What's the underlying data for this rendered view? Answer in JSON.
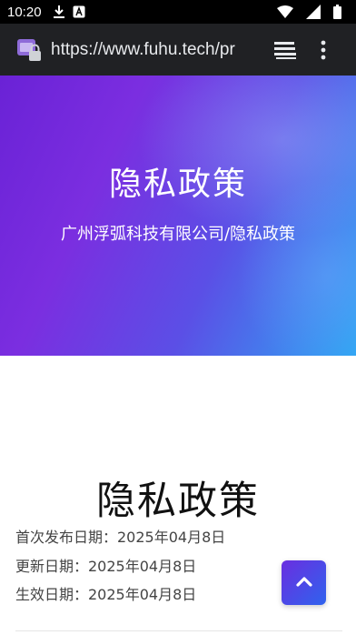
{
  "status_bar": {
    "time": "10:20",
    "icons_left": [
      "download-icon",
      "translate-icon"
    ],
    "icons_right": [
      "wifi-icon",
      "signal-icon",
      "battery-icon"
    ]
  },
  "browser": {
    "url": "https://www.fuhu.tech/pr",
    "icons": [
      "site-lock-icon",
      "tabs-icon",
      "overflow-menu-icon"
    ]
  },
  "hero": {
    "title": "隐私政策",
    "breadcrumb": "广州浮弧科技有限公司/隐私政策",
    "gradient_colors": [
      "#6a22d6",
      "#5b4fe6",
      "#2fa6f3"
    ]
  },
  "content": {
    "title": "隐私政策",
    "first_published": "首次发布日期：2025年04月8日",
    "updated": "更新日期：2025年04月8日",
    "effective": "生效日期：2025年04月8日"
  },
  "back_to_top": {
    "icon": "chevron-up-icon",
    "colors": [
      "#6a2ee0",
      "#2f63ee"
    ]
  }
}
